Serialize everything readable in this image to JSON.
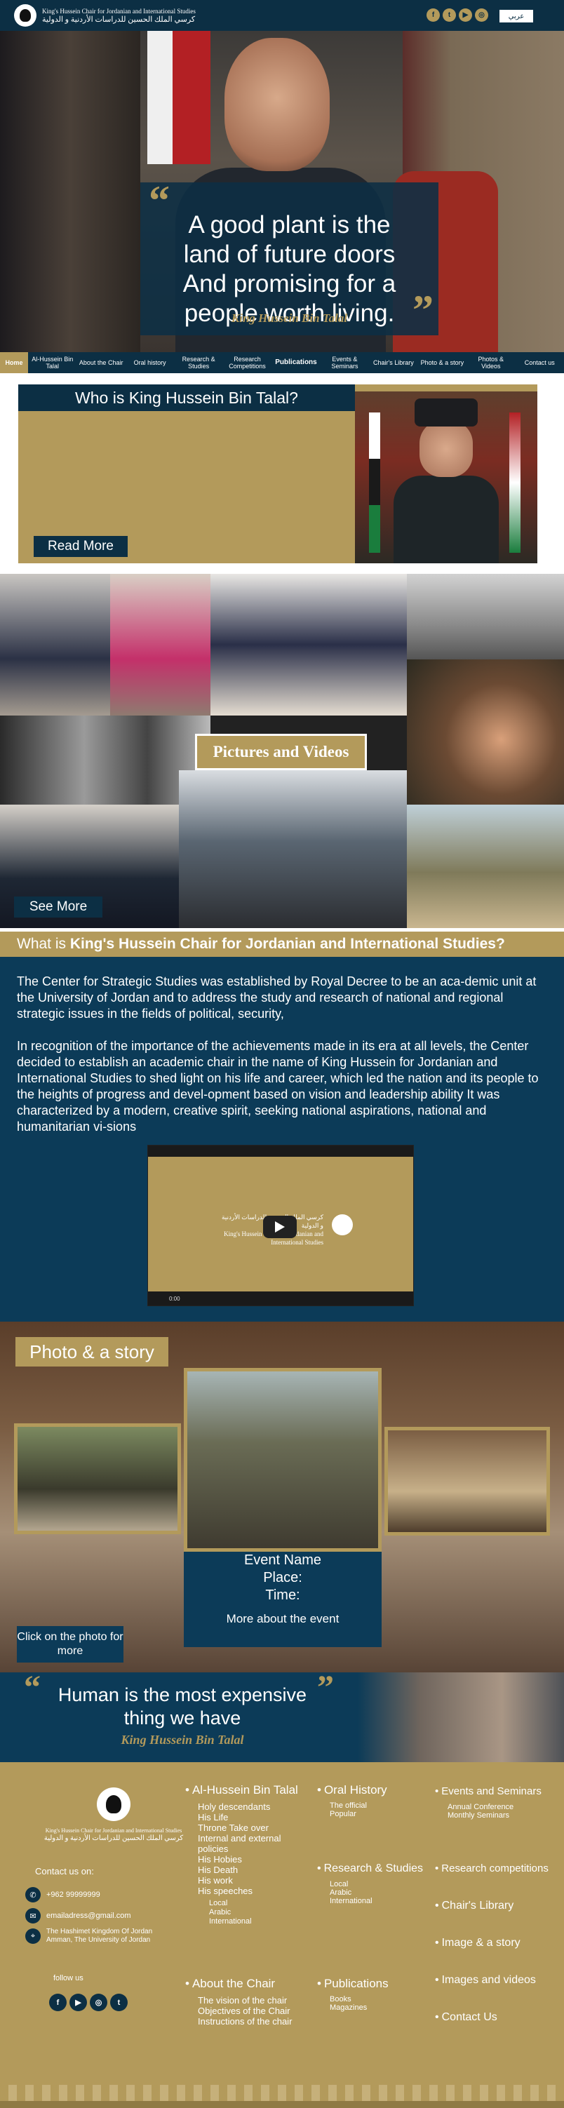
{
  "header": {
    "logo_en": "King's Hussein Chair for Jordanian and International Studies",
    "logo_ar": "كرسي الملك الحسين للدراسات الأردنية و الدولية",
    "socials": [
      "f",
      "t",
      "▶",
      "◎"
    ],
    "language": "عربي"
  },
  "hero": {
    "quote_lines": [
      "A good plant is the",
      "land of future doors",
      "And promising for a",
      "people worth living."
    ],
    "signature": "King Hussein Bin Talal"
  },
  "nav": {
    "items": [
      "Home",
      "Al-Hussein Bin Talal",
      "About the Chair",
      "Oral history",
      "Research & Studies",
      "Research Competitions",
      "Publications",
      "Events & Seminars",
      "Chair's Library",
      "Photo & a story",
      "Photos & Videos",
      "Contact us"
    ]
  },
  "who": {
    "title": "Who is King Hussein Bin Talal?",
    "read_more": "Read More"
  },
  "gallery": {
    "label": "Pictures and Videos",
    "see_more": "See More"
  },
  "about": {
    "question_prefix": "What is ",
    "question_bold": "King's Hussein Chair for Jordanian and International Studies?",
    "paragraph1": "The Center for Strategic Studies was established by Royal Decree to be an aca-demic unit at the University of Jordan and to address the study and research of national and regional strategic issues in the fields of political, security,",
    "paragraph2": "In recognition of the importance of the achievements made in its era at all levels, the Center decided to establish an academic chair in the name of King Hussein for Jordanian and International Studies to shed light on his life and career, which led the nation and its people to the heights of progress and devel-opment based on vision and leadership ability It was characterized by a modern, creative spirit, seeking national aspirations, national and humanitarian vi-sions",
    "video_logo_ar": "كرسي الملك الحسين للدراسات الأردنية و الدولية",
    "video_logo_en": "King's Hussein Chair for Jordanian and International Studies",
    "video_time": "0:00"
  },
  "photo_story": {
    "title": "Photo & a story",
    "event_name": "Event Name",
    "place": "Place:",
    "time": "Time:",
    "more": "More about the event",
    "click": "Click on the photo for more"
  },
  "human": {
    "quote_lines": [
      "Human is the most expensive",
      "thing we have"
    ],
    "signature": "King Hussein Bin Talal"
  },
  "footer": {
    "logo_en": "King's Hussein Chair for Jordanian and International Studies",
    "logo_ar": "كرسي الملك الحسين للدراسات الأردنية و الدولية",
    "contact_label": "Contact us on:",
    "phone": "+962 99999999",
    "email": "emailadress@gmail.com",
    "address_line1": "The Hashimet Kingdom Of Jordan",
    "address_line2": "Amman, The University of Jordan",
    "follow": "follow us",
    "col1_title": "Al-Hussein Bin Talal",
    "col1_items": [
      "Holy descendants",
      "His Life",
      "Throne Take over",
      "Internal and external",
      "policies",
      "His Hobies",
      "His Death",
      "His work",
      "His speeches"
    ],
    "col1_sub": [
      "Local",
      "Arabic",
      "International"
    ],
    "col1b_title": "About the Chair",
    "col1b_items": [
      "The vision of the chair",
      "Objectives of the Chair",
      "Instructions of the chair"
    ],
    "col2_title": "Oral History",
    "col2_items": [
      "The official",
      "Popular"
    ],
    "col2b_title": "Research & Studies",
    "col2b_items": [
      "Local",
      "Arabic",
      "International"
    ],
    "col2c_title": "Publications",
    "col2c_items": [
      "Books",
      "Magazines"
    ],
    "col3_title": "Events and Seminars",
    "col3_items": [
      "Annual Conference",
      "Monthly Seminars"
    ],
    "col3_links": [
      "Research competitions",
      "Chair's Library",
      "Image & a story",
      "Images and videos",
      "Contact Us"
    ]
  },
  "colors": {
    "navy": "#0c2f44",
    "gold": "#b39a5b",
    "teal": "#0c3b58"
  }
}
